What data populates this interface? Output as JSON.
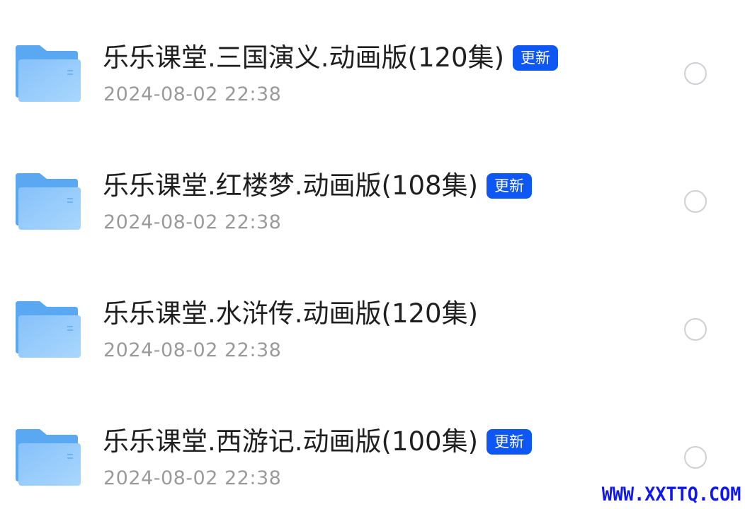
{
  "files": [
    {
      "name": "乐乐课堂.三国演义.动画版(120集)",
      "badge": "更新",
      "time": "2024-08-02 22:38",
      "icon": "folder-icon",
      "selected": false
    },
    {
      "name": "乐乐课堂.红楼梦.动画版(108集)",
      "badge": "更新",
      "time": "2024-08-02 22:38",
      "icon": "folder-icon",
      "selected": false
    },
    {
      "name": "乐乐课堂.水浒传.动画版(120集)",
      "badge": null,
      "time": "2024-08-02 22:38",
      "icon": "folder-icon",
      "selected": false
    },
    {
      "name": "乐乐课堂.西游记.动画版(100集)",
      "badge": "更新",
      "time": "2024-08-02 22:38",
      "icon": "folder-icon",
      "selected": false
    }
  ],
  "watermark": "WWW.XXTTQ.COM",
  "colors": {
    "badge_bg": "#0e57f5",
    "title": "#1f1f1f",
    "time": "#9a9a9a",
    "radio_border": "#cfcfd4",
    "folder_back": "#5aa8f2",
    "folder_front": "#9fd0fb",
    "watermark": "#0f16ee"
  }
}
